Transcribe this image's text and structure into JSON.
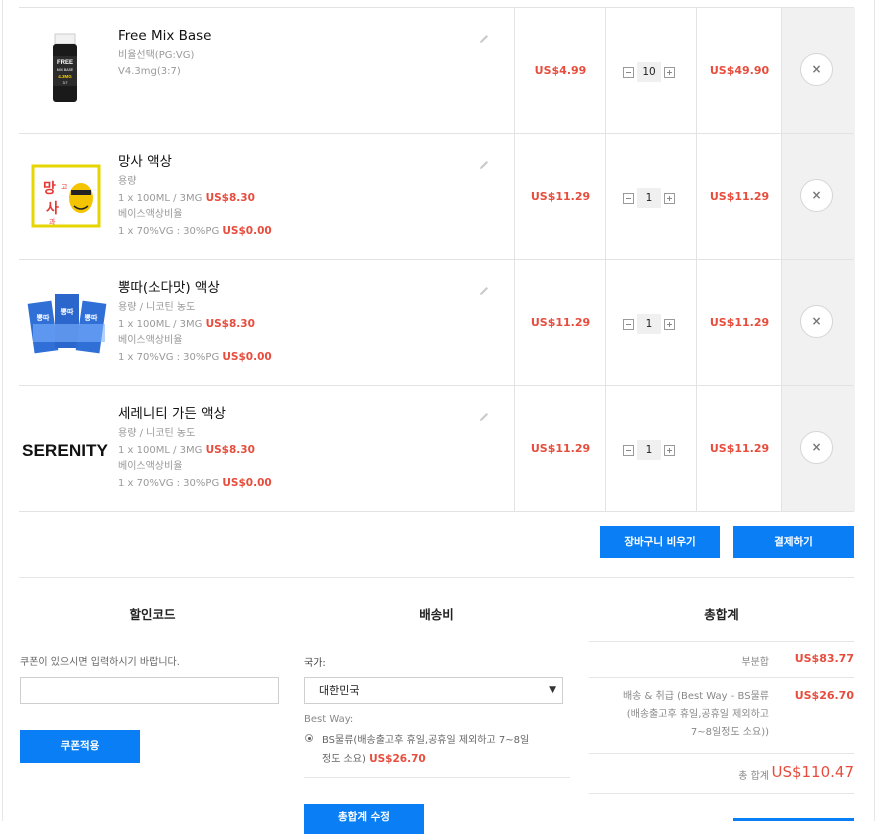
{
  "cart": {
    "items": [
      {
        "name": "Free Mix Base",
        "options": [
          {
            "label": "비율선택(PG:VG)",
            "extra": ""
          },
          {
            "label": "V4.3mg(3:7)",
            "extra": ""
          }
        ],
        "price": "US$4.99",
        "qty": "10",
        "subtotal": "US$49.90",
        "thumb_text": [
          "FREE",
          "MIX BASE",
          "4.3MG",
          "3:7"
        ]
      },
      {
        "name": "망사 액상",
        "options": [
          {
            "label": "용량",
            "extra": ""
          },
          {
            "label": "1 x 100ML / 3MG",
            "extra": "US$8.30"
          },
          {
            "label": "베이스액상비율",
            "extra": ""
          },
          {
            "label": "1 x 70%VG : 30%PG",
            "extra": "US$0.00"
          }
        ],
        "price": "US$11.29",
        "qty": "1",
        "subtotal": "US$11.29",
        "thumb_text": [
          "망",
          "고",
          "사",
          "과"
        ]
      },
      {
        "name": "뽕따(소다맛) 액상",
        "options": [
          {
            "label": "용량 / 니코틴 농도",
            "extra": ""
          },
          {
            "label": "1 x 100ML / 3MG",
            "extra": "US$8.30"
          },
          {
            "label": "베이스액상비율",
            "extra": ""
          },
          {
            "label": "1 x 70%VG : 30%PG",
            "extra": "US$0.00"
          }
        ],
        "price": "US$11.29",
        "qty": "1",
        "subtotal": "US$11.29",
        "thumb_text": [
          "뽕따",
          "뽕따",
          "뽕따"
        ]
      },
      {
        "name": "세레니티 가든 액상",
        "options": [
          {
            "label": "용량 / 니코틴 농도",
            "extra": ""
          },
          {
            "label": "1 x 100ML / 3MG",
            "extra": "US$8.30"
          },
          {
            "label": "베이스액상비율",
            "extra": ""
          },
          {
            "label": "1 x 70%VG : 30%PG",
            "extra": "US$0.00"
          }
        ],
        "price": "US$11.29",
        "qty": "1",
        "subtotal": "US$11.29",
        "thumb_text": [
          "SERENITY"
        ]
      }
    ],
    "empty_label": "장바구니 비우기",
    "checkout_label": "결제하기",
    "remove_glyph": "×"
  },
  "coupon": {
    "title": "할인코드",
    "hint": "쿠폰이 있으시면 입력하시기 바랍니다.",
    "input_value": "",
    "apply_label": "쿠폰적용"
  },
  "shipping": {
    "title": "배송비",
    "country_label": "국가:",
    "country_value": "대한민국",
    "method_heading": "Best Way:",
    "method_line1": "BS물류(배송출고후 휴일,공휴일 제외하고 7~8일",
    "method_line2": "정도 소요)",
    "method_price": "US$26.70",
    "update_label": "총합계 수정"
  },
  "totals": {
    "title": "총합계",
    "subtotal_label": "부분합",
    "subtotal_value": "US$83.77",
    "ship_label_1": "배송 & 취급 (Best Way - BS물류",
    "ship_label_2": "(배송출고후 휴일,공휴일 제외하고",
    "ship_label_3": "7~8일정도 소요))",
    "ship_value": "US$26.70",
    "total_label": "총 합계",
    "total_value": "US$110.47"
  },
  "colors": {
    "accent": "#0a7ff5",
    "price": "#e74c3c"
  }
}
